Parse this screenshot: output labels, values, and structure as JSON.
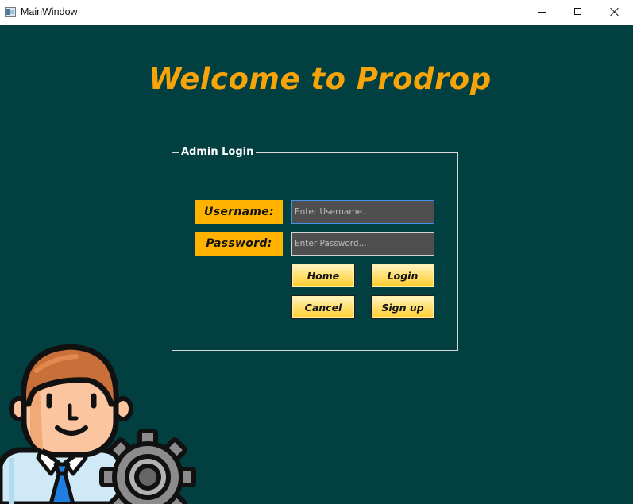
{
  "window": {
    "title": "MainWindow",
    "controls": [
      "minimize",
      "maximize",
      "close"
    ]
  },
  "colors": {
    "background": "#023f40",
    "accent": "#f7a30a",
    "label_background": "#ffb300",
    "button_gradient": "#ffe27a",
    "input_background": "#4f4f4f"
  },
  "header": {
    "welcome": "Welcome to Prodrop"
  },
  "login_group": {
    "title": "Admin Login",
    "username_label": "Username:",
    "password_label": "Password:",
    "username_placeholder": "Enter Username...",
    "password_placeholder": "Enter Password..."
  },
  "buttons": {
    "home": "Home",
    "login": "Login",
    "cancel": "Cancel",
    "signup": "Sign up"
  },
  "illustration": {
    "icon": "admin-user-with-gear-icon"
  }
}
